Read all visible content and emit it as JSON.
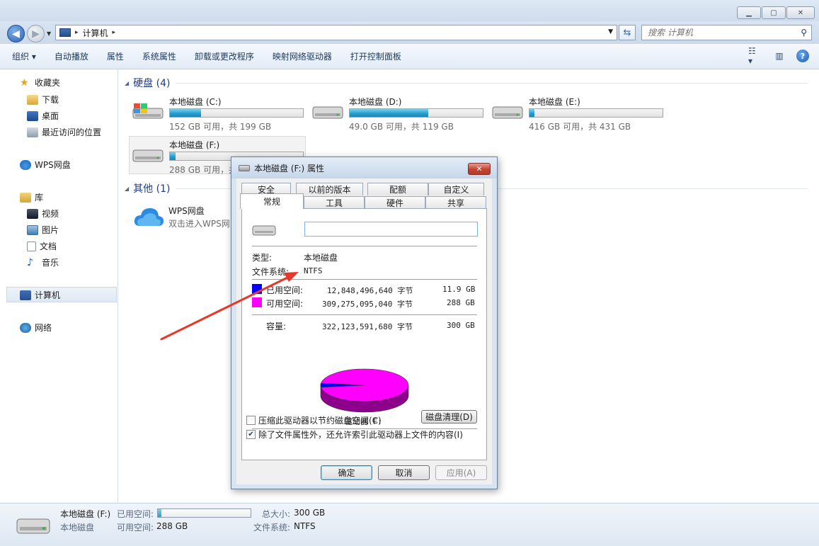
{
  "window": {
    "minimize_icon": "minimize-icon",
    "maximize_icon": "maximize-icon",
    "close_icon": "close-icon"
  },
  "address": {
    "crumb": "计算机",
    "search_placeholder": "搜索 计算机"
  },
  "toolbar": {
    "organize": "组织 ▾",
    "autoplay": "自动播放",
    "properties": "属性",
    "system_properties": "系统属性",
    "uninstall": "卸载或更改程序",
    "map_drive": "映射网络驱动器",
    "control_panel": "打开控制面板"
  },
  "nav": {
    "favorites": "收藏夹",
    "downloads": "下载",
    "desktop": "桌面",
    "recent": "最近访问的位置",
    "wps": "WPS网盘",
    "libraries": "库",
    "videos": "视频",
    "pictures": "图片",
    "documents": "文档",
    "music": "音乐",
    "computer": "计算机",
    "network": "网络"
  },
  "groups": {
    "hard_disks": "硬盘 (4)",
    "other": "其他 (1)"
  },
  "drives": [
    {
      "name": "本地磁盘 (C:)",
      "size": "152 GB 可用，共 199 GB",
      "used_fraction": 0.236
    },
    {
      "name": "本地磁盘 (D:)",
      "size": "49.0 GB 可用，共 119 GB",
      "used_fraction": 0.588
    },
    {
      "name": "本地磁盘 (E:)",
      "size": "416 GB 可用，共 431 GB",
      "used_fraction": 0.035
    },
    {
      "name": "本地磁盘 (F:)",
      "size": "288 GB 可用，共",
      "used_fraction": 0.04
    }
  ],
  "wps_item": {
    "name": "WPS网盘",
    "desc": "双击进入WPS网"
  },
  "status": {
    "name": "本地磁盘 (F:)",
    "type": "本地磁盘",
    "used_label": "已用空间:",
    "free_label": "可用空间:",
    "free_value": "288 GB",
    "total_label": "总大小:",
    "total_value": "300 GB",
    "fs_label": "文件系统:",
    "fs_value": "NTFS",
    "used_fraction": 0.04
  },
  "dialog": {
    "title": "本地磁盘 (F:) 属性",
    "tabs_top": [
      "安全",
      "以前的版本",
      "配额",
      "自定义"
    ],
    "tabs_bottom": [
      "常规",
      "工具",
      "硬件",
      "共享"
    ],
    "name_value": "",
    "type_label": "类型:",
    "type_value": "本地磁盘",
    "fs_label": "文件系统:",
    "fs_value": "NTFS",
    "used_label": "已用空间:",
    "used_bytes": "12,848,496,640 字节",
    "used_gb": "11.9 GB",
    "free_label": "可用空间:",
    "free_bytes": "309,275,095,040 字节",
    "free_gb": "288 GB",
    "cap_label": "容量:",
    "cap_bytes": "322,123,591,680 字节",
    "cap_gb": "300 GB",
    "drive_label": "驱动器 F:",
    "cleanup": "磁盘清理(D)",
    "compress": "压缩此驱动器以节约磁盘空间(C)",
    "index": "除了文件属性外，还允许索引此驱动器上文件的内容(I)",
    "ok": "确定",
    "cancel": "取消",
    "apply": "应用(A)",
    "used_color": "#0000ff",
    "free_color": "#ff00ff",
    "used_fraction": 0.04
  }
}
